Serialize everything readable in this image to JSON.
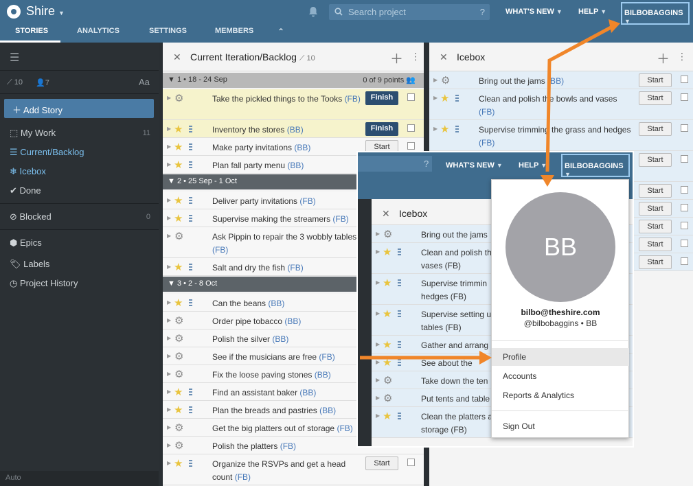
{
  "header": {
    "project": "Shire",
    "search_placeholder": "Search project",
    "search_help": "?",
    "whats_new": "WHAT'S NEW",
    "help": "HELP",
    "user": "BILBOBAGGINS"
  },
  "tabs": [
    "STORIES",
    "ANALYTICS",
    "SETTINGS",
    "MEMBERS"
  ],
  "sidebar": {
    "velocity": "10",
    "members": "7",
    "font_toggle": "Aa",
    "add_story": "Add Story",
    "items": [
      {
        "label": "My Work",
        "count": "11"
      },
      {
        "label": "Current/Backlog",
        "count": ""
      },
      {
        "label": "Icebox",
        "count": ""
      },
      {
        "label": "Done",
        "count": ""
      },
      {
        "label": "Blocked",
        "count": "0"
      },
      {
        "label": "Epics",
        "count": ""
      },
      {
        "label": "Labels",
        "count": ""
      },
      {
        "label": "Project History",
        "count": ""
      }
    ],
    "footer": "Auto"
  },
  "backlog": {
    "title": "Current Iteration/Backlog",
    "velocity": "10",
    "iterations": [
      {
        "label": "1 • 18 - 24 Sep",
        "points": "0 of 9 points"
      },
      {
        "label": "2 • 25 Sep - 1 Oct"
      },
      {
        "label": "3 • 2 - 8 Oct"
      }
    ],
    "stories": [
      {
        "title": "Take the pickled things to the Tooks",
        "label": "(FB)",
        "button": "Finish"
      },
      {
        "title": "Inventory the stores",
        "label": "(BB)",
        "button": "Finish"
      },
      {
        "title": "Make party invitations",
        "label": "(BB)",
        "button": "Start"
      },
      {
        "title": "Plan fall party menu",
        "label": "(BB)",
        "button": ""
      },
      {
        "title": "Deliver party invitations",
        "label": "(FB)",
        "button": ""
      },
      {
        "title": "Supervise making the streamers",
        "label": "(FB)",
        "button": ""
      },
      {
        "title": "Ask Pippin to repair the 3 wobbly tables for the fall party",
        "label": "(FB)",
        "button": ""
      },
      {
        "title": "Salt and dry the fish",
        "label": "(FB)",
        "button": ""
      },
      {
        "title": "Can the beans",
        "label": "(BB)",
        "button": ""
      },
      {
        "title": "Order pipe tobacco",
        "label": "(BB)",
        "button": ""
      },
      {
        "title": "Polish the silver",
        "label": "(BB)",
        "button": ""
      },
      {
        "title": "See if the musicians are free",
        "label": "(FB)",
        "button": ""
      },
      {
        "title": "Fix the loose paving stones",
        "label": "(BB)",
        "button": ""
      },
      {
        "title": "Find an assistant baker",
        "label": "(BB)",
        "button": ""
      },
      {
        "title": "Plan the breads and pastries",
        "label": "(BB)",
        "button": ""
      },
      {
        "title": "Get the big platters out of storage",
        "label": "(FB)",
        "button": ""
      },
      {
        "title": "Polish the platters",
        "label": "(FB)",
        "button": ""
      },
      {
        "title": "Organize the RSVPs and get a head count",
        "label": "(FB)",
        "button": "Start"
      }
    ]
  },
  "icebox": {
    "title": "Icebox",
    "start_label": "Start",
    "stories": [
      {
        "title": "Bring out the jams",
        "label": "(BB)"
      },
      {
        "title": "Clean and polish the bowls and vases",
        "label": "(FB)"
      },
      {
        "title": "Supervise trimming the grass and hedges",
        "label": "(FB)"
      }
    ]
  },
  "overlay": {
    "whats_new": "WHAT'S NEW",
    "help": "HELP",
    "user": "BILBOBAGGINS",
    "search_help": "?",
    "icebox_title": "Icebox",
    "stories": [
      {
        "title": "Bring out the jams",
        "label": ""
      },
      {
        "title": "Clean and polish th",
        "label": "vases (FB)"
      },
      {
        "title": "Supervise trimmin",
        "label": "hedges (FB)"
      },
      {
        "title": "Supervise setting u",
        "label": "tables (FB)"
      },
      {
        "title": "Gather and arrang",
        "label": ""
      },
      {
        "title": "See about the",
        "label": ""
      },
      {
        "title": "Take down the ten",
        "label": ""
      },
      {
        "title": "Put tents and table",
        "label": ""
      },
      {
        "title": "Clean the platters a",
        "label": "storage (FB)"
      }
    ]
  },
  "dropdown": {
    "initials": "BB",
    "email": "bilbo@theshire.com",
    "username": "@bilbobaggins",
    "initials_short": "BB",
    "items": [
      "Profile",
      "Accounts",
      "Reports & Analytics",
      "Sign Out"
    ]
  },
  "colors": {
    "header": "#3f6c8e",
    "sidebar": "#2b3034",
    "finish": "#2c4e70",
    "callout": "#f0862a"
  }
}
